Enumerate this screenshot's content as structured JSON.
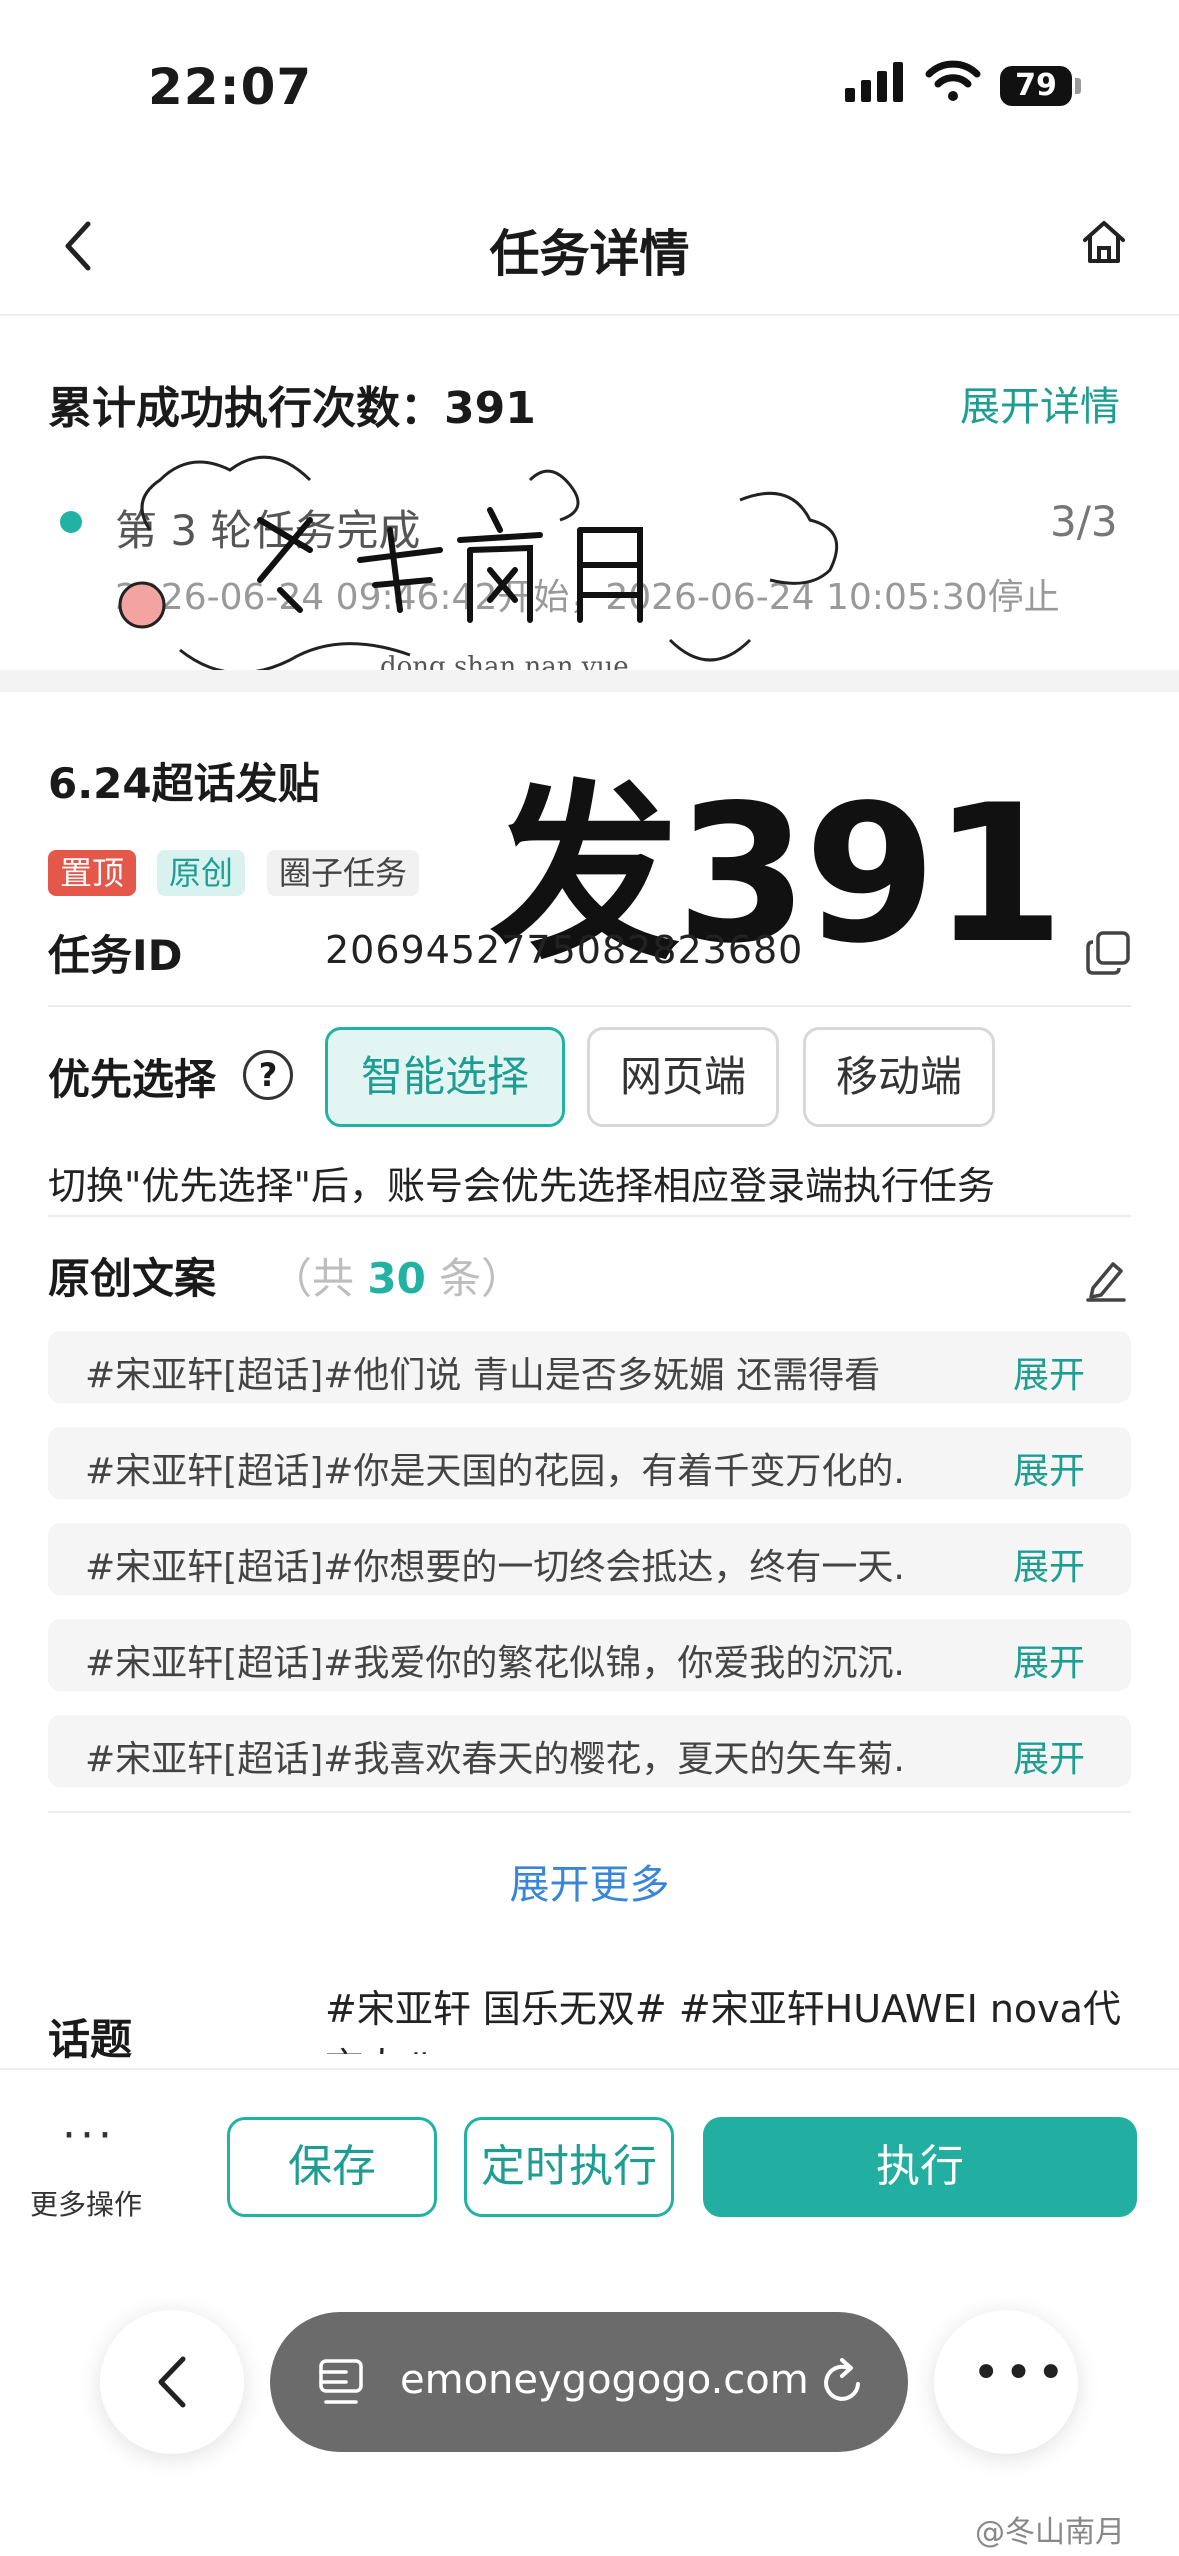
{
  "status_bar": {
    "time": "22:07",
    "battery": "79"
  },
  "nav": {
    "title": "任务详情"
  },
  "summary": {
    "label": "累计成功执行次数：391",
    "expand": "展开详情",
    "round_text": "第 3 轮任务完成",
    "round_count": "3/3",
    "round_time": "2026-06-24 09:46:42开始，2026-06-24 10:05:30停止"
  },
  "task": {
    "name": "6.24超话发贴",
    "overlay": "发391",
    "tags": [
      "置顶",
      "原创",
      "圈子任务"
    ],
    "id_label": "任务ID",
    "id_value": "2069452775082823680"
  },
  "priority": {
    "label": "优先选择",
    "help": "?",
    "options": [
      "智能选择",
      "网页端",
      "移动端"
    ],
    "selected": "智能选择",
    "hint": "切换\"优先选择\"后，账号会优先选择相应登录端执行任务"
  },
  "copies": {
    "title": "原创文案",
    "count_prefix": "（共 ",
    "count": "30",
    "count_suffix": " 条）",
    "items": [
      {
        "text": "#宋亚轩[超话]#他们说 青山是否多妩媚 还需得看",
        "expand": "展开"
      },
      {
        "text": "#宋亚轩[超话]#你是天国的花园，有着千变万化的.",
        "expand": "展开"
      },
      {
        "text": "#宋亚轩[超话]#你想要的一切终会抵达，终有一天.",
        "expand": "展开"
      },
      {
        "text": "#宋亚轩[超话]#我爱你的繁花似锦，你爱我的沉沉.",
        "expand": "展开"
      },
      {
        "text": "#宋亚轩[超话]#我喜欢春天的樱花，夏天的矢车菊.",
        "expand": "展开"
      }
    ],
    "more": "展开更多"
  },
  "topic": {
    "label": "话题",
    "value": "#宋亚轩 国乐无双# #宋亚轩HUAWEI nova代言人#"
  },
  "bottom": {
    "more_dots": "···",
    "more_label": "更多操作",
    "save": "保存",
    "schedule": "定时执行",
    "execute": "执行"
  },
  "browser": {
    "url": "emoneygogogo.com"
  },
  "watermark": {
    "text": "冬山南月",
    "romanized": "dong shan  nan yue",
    "credit": "@冬山南月"
  }
}
